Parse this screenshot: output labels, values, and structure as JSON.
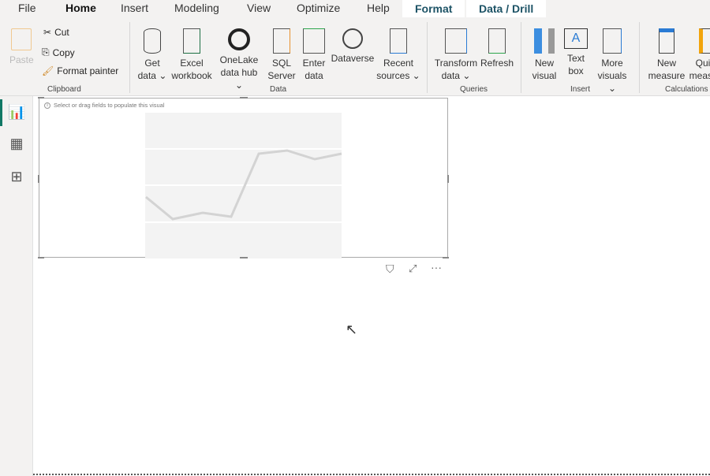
{
  "tabs": [
    {
      "label": "File"
    },
    {
      "label": "Home",
      "active": true
    },
    {
      "label": "Insert"
    },
    {
      "label": "Modeling"
    },
    {
      "label": "View"
    },
    {
      "label": "Optimize"
    },
    {
      "label": "Help"
    },
    {
      "label": "Format"
    },
    {
      "label": "Data / Drill"
    }
  ],
  "clipboard": {
    "paste": "Paste",
    "cut": "Cut",
    "copy": "Copy",
    "format_painter": "Format painter",
    "group": "Clipboard"
  },
  "data_group": {
    "get_data": [
      "Get",
      "data ⌄"
    ],
    "excel": [
      "Excel",
      "workbook"
    ],
    "onelake": [
      "OneLake",
      "data hub ⌄"
    ],
    "sql": [
      "SQL",
      "Server"
    ],
    "enter": [
      "Enter",
      "data"
    ],
    "dataverse": [
      "Dataverse",
      ""
    ],
    "recent": [
      "Recent",
      "sources ⌄"
    ],
    "group": "Data"
  },
  "queries": {
    "transform": [
      "Transform",
      "data ⌄"
    ],
    "refresh": [
      "Refresh",
      ""
    ],
    "group": "Queries"
  },
  "insert": {
    "new_visual": [
      "New",
      "visual"
    ],
    "text_box": [
      "Text",
      "box"
    ],
    "more_visuals": [
      "More",
      "visuals ⌄"
    ],
    "group": "Insert"
  },
  "calculations": {
    "new_measure": [
      "New",
      "measure"
    ],
    "quick_measure": [
      "Quick",
      "measure"
    ],
    "group": "Calculations"
  },
  "visual": {
    "hint": "Select or drag fields to populate this visual"
  },
  "colors": {
    "accent": "#117865",
    "ribbon_bg": "#f3f2f1"
  }
}
